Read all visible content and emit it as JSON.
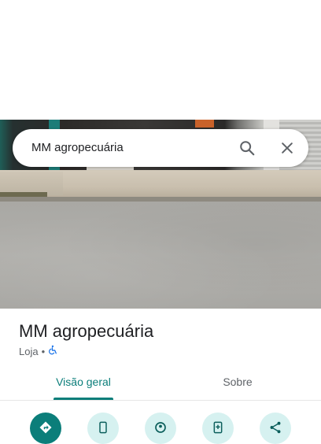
{
  "search": {
    "query": "MM agropecuária"
  },
  "place": {
    "name": "MM agropecuária",
    "category": "Loja",
    "separator": "•"
  },
  "tabs": [
    {
      "label": "Visão geral",
      "active": true
    },
    {
      "label": "Sobre",
      "active": false
    }
  ],
  "actions": [
    {
      "icon": "directions-icon"
    },
    {
      "icon": "phone-icon"
    },
    {
      "icon": "location-pin-icon"
    },
    {
      "icon": "add-to-list-icon"
    },
    {
      "icon": "share-icon"
    }
  ],
  "colors": {
    "accent": "#0b7e7a",
    "action_bg": "#d6f1f0",
    "text_primary": "#202124",
    "text_secondary": "#5f6368",
    "accessibility_icon": "#1a73e8"
  }
}
